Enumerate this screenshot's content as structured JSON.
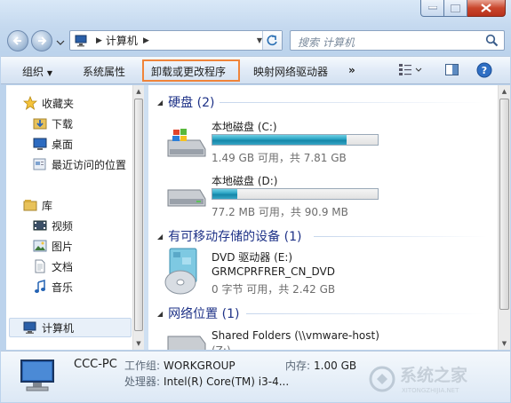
{
  "nav": {
    "address_crumb": "计算机",
    "search_placeholder": "搜索 计算机"
  },
  "toolbar": {
    "organize": "组织",
    "system_properties": "系统属性",
    "uninstall": "卸载或更改程序",
    "map_network": "映射网络驱动器",
    "more": "»"
  },
  "sidebar": {
    "favorites": "收藏夹",
    "downloads": "下载",
    "desktop": "桌面",
    "recent": "最近访问的位置",
    "libraries": "库",
    "videos": "视频",
    "pictures": "图片",
    "documents": "文档",
    "music": "音乐",
    "computer": "计算机"
  },
  "groups": {
    "hard_disks": "硬盘 (2)",
    "removable": "有可移动存储的设备 (1)",
    "network": "网络位置 (1)"
  },
  "drives": [
    {
      "name": "本地磁盘 (C:)",
      "space": "1.49 GB 可用，共 7.81 GB",
      "used_fraction": 0.81
    },
    {
      "name": "本地磁盘 (D:)",
      "space": "77.2 MB 可用，共 90.9 MB",
      "used_fraction": 0.15
    }
  ],
  "dvd": {
    "name": "DVD 驱动器 (E:)",
    "label": "GRMCPRFRER_CN_DVD",
    "space": "0 字节 可用，共 2.42 GB"
  },
  "network_item": {
    "name": "Shared Folders (\\\\vmware-host)",
    "sub": "(Z:)"
  },
  "details": {
    "pc_name": "CCC-PC",
    "workgroup_label": "工作组:",
    "workgroup": "WORKGROUP",
    "memory_label": "内存:",
    "memory": "1.00 GB",
    "cpu_label": "处理器:",
    "cpu": "Intel(R) Core(TM) i3-4..."
  },
  "watermark": {
    "text": "系统之家",
    "sub": "XITONGZHIJIA.NET"
  },
  "colors": {
    "accent_blue": "#1e3287",
    "bar_fill": "#27a2c3",
    "highlight": "#f0843a"
  }
}
